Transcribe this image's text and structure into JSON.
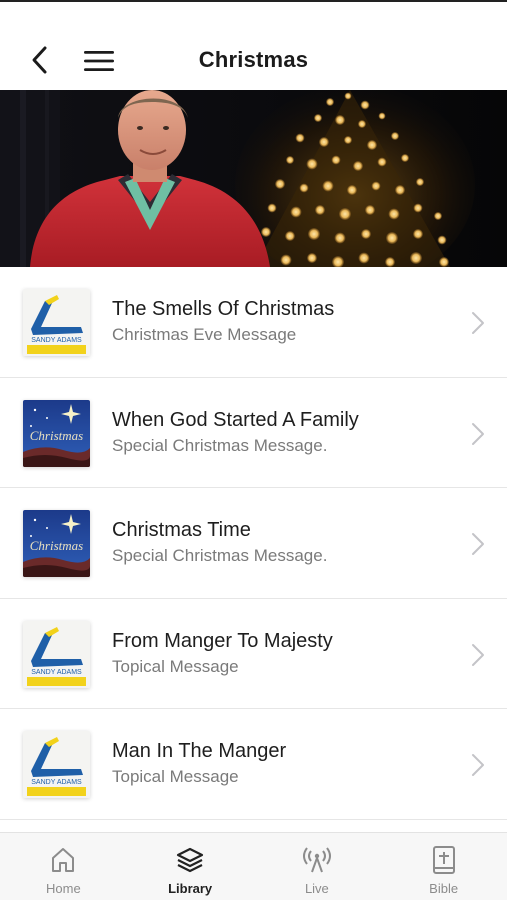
{
  "header": {
    "title": "Christmas",
    "back_icon": "back-arrow-icon",
    "menu_icon": "hamburger-menu-icon"
  },
  "hero": {
    "image": "man-in-red-jacket-with-christmas-tree-lights"
  },
  "messages": [
    {
      "title": "The Smells Of Christmas",
      "subtitle": "Christmas Eve Message",
      "thumb": "sandy-adams-logo",
      "thumb_text": "SANDY ADAMS"
    },
    {
      "title": "When God Started A Family",
      "subtitle": "Special Christmas Message.",
      "thumb": "christmas-art",
      "thumb_text": "Christmas"
    },
    {
      "title": "Christmas Time",
      "subtitle": "Special Christmas Message.",
      "thumb": "christmas-art",
      "thumb_text": "Christmas"
    },
    {
      "title": "From Manger To Majesty",
      "subtitle": "Topical Message",
      "thumb": "sandy-adams-logo",
      "thumb_text": "SANDY ADAMS"
    },
    {
      "title": "Man In The Manger",
      "subtitle": "Topical Message",
      "thumb": "sandy-adams-logo",
      "thumb_text": "SANDY ADAMS"
    }
  ],
  "tabbar": {
    "tabs": [
      {
        "label": "Home",
        "icon": "home-icon",
        "active": false
      },
      {
        "label": "Library",
        "icon": "library-layers-icon",
        "active": true
      },
      {
        "label": "Live",
        "icon": "live-broadcast-icon",
        "active": false
      },
      {
        "label": "Bible",
        "icon": "bible-icon",
        "active": false
      }
    ]
  },
  "colors": {
    "logo_blue": "#1f5fa8",
    "logo_yellow": "#f2d21b",
    "active_tab": "#222222",
    "inactive_tab": "#8c8c8c",
    "jacket_red": "#c9272f"
  }
}
